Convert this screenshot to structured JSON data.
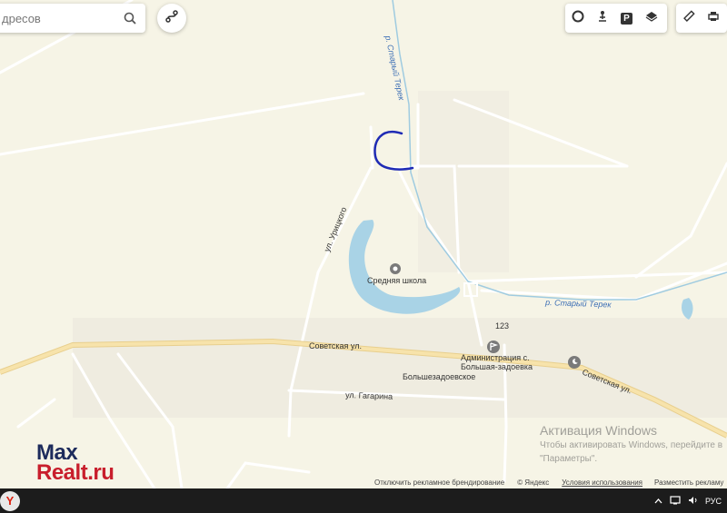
{
  "search": {
    "placeholder": "дресов"
  },
  "toolbar": {
    "icons": [
      "traffic-icon",
      "panorama-icon",
      "parking-icon",
      "layers-icon",
      "ruler-icon",
      "print-icon"
    ],
    "parking_glyph": "P"
  },
  "map_labels": {
    "river_top": "р. Старый Терек",
    "river_right": "р. Старый Терек",
    "street_uritskogo": "ул. Урицкого",
    "school": "Средняя школа",
    "number_123": "123",
    "street_sovetskaya_left": "Советская ул.",
    "street_sovetskaya_right": "Советская ул.",
    "administration": "Администрация с. Большая-задоевка",
    "admin_line1": "Администрация с.",
    "admin_line2": "Большая-задоевка",
    "village": "Большезадоевское",
    "street_gagarina": "ул. Гагарина"
  },
  "footer": {
    "disable_ads": "Отключить рекламное брендирование",
    "yandex": "© Яндекс",
    "terms": "Условия использования",
    "ad_settings": "Разместить рекламу"
  },
  "watermark": {
    "title": "Активация Windows",
    "line1": "Чтобы активировать Windows, перейдите в",
    "line2": "\"Параметры\"."
  },
  "logo": {
    "max": "Max",
    "realt": "Realt.ru"
  },
  "taskbar": {
    "start": "Y",
    "lang": "РУС"
  },
  "colors": {
    "background": "#f6f4e6",
    "road": "#ffffff",
    "main_road": "#f3dca0",
    "water": "#a9d3e6",
    "marker": "#1f2bb5"
  }
}
